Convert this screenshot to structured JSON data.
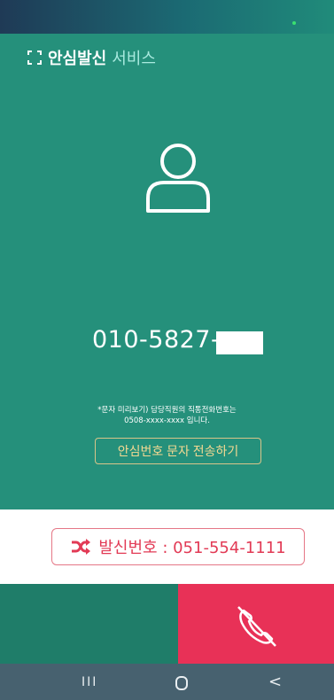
{
  "brand": {
    "strong": "안심발신",
    "light": "서비스"
  },
  "main": {
    "phone_number": "010-5827-",
    "note_line1": "*문자 미리보기) 담당직원의 직통전화번호는",
    "note_line2": "0508-xxxx-xxxx 입니다.",
    "sms_button": "안심번호 문자 전송하기"
  },
  "caller": {
    "label": "발신번호 : 051-554-1111"
  },
  "nav": {
    "recents": "III",
    "back": "<"
  },
  "colors": {
    "green": "#25907b",
    "red": "#e83157",
    "gold": "#f4d992"
  },
  "icons": {
    "brand": "brand-icon",
    "avatar": "person-icon",
    "shuffle": "shuffle-icon",
    "call_end": "hangup-icon"
  }
}
